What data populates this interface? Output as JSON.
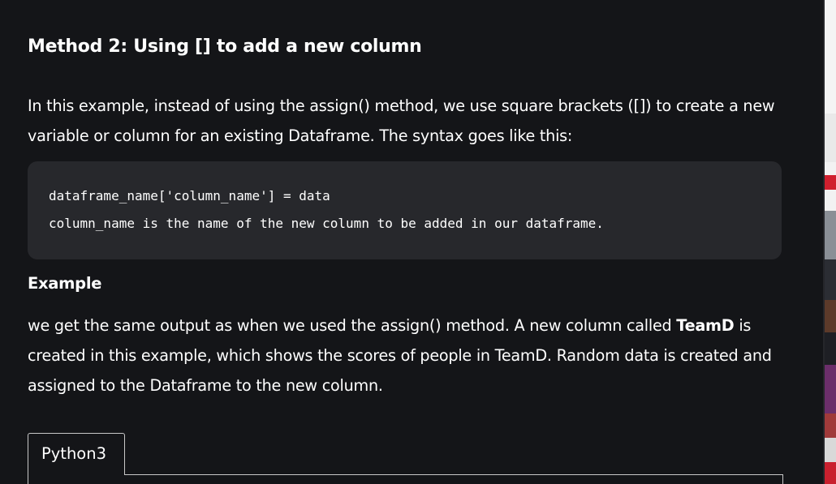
{
  "article": {
    "heading": "Method 2: Using [] to add a new column",
    "intro_text": "In this example, instead of using the assign() method, we use square brackets ([]) to create a new variable or column for an existing Dataframe. The syntax goes like this:",
    "code": {
      "line1": "dataframe_name['column_name'] = data",
      "line2": "column_name is the name of the new column to be added in our dataframe."
    },
    "example_heading": "Example",
    "example_text_before": "we get the same output as when we used the assign() method. A new column called ",
    "example_text_bold": "TeamD",
    "example_text_after": " is created in this example, which shows the scores of people in TeamD. Random data is created and assigned to the Dataframe to the new column.",
    "tab_label": "Python3"
  }
}
